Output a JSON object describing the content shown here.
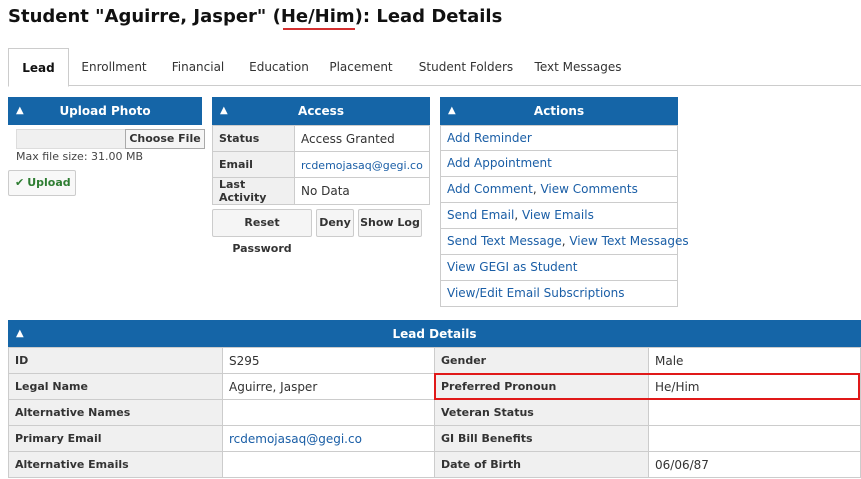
{
  "page": {
    "title_prefix": "Student \"Aguirre, Jasper\" (",
    "title_pronoun": "He/Him",
    "title_suffix": "): Lead Details"
  },
  "tabs": [
    "Lead",
    "Enrollment",
    "Financial",
    "Education",
    "Placement",
    "Student Folders",
    "Text Messages"
  ],
  "upload_photo": {
    "header": "Upload Photo",
    "choose_file_label": "Choose File",
    "max_size_text": "Max file size: 31.00 MB",
    "upload_label": "Upload"
  },
  "access": {
    "header": "Access",
    "rows": [
      {
        "label": "Status",
        "value": "Access Granted"
      },
      {
        "label": "Email",
        "value": "rcdemojasaq@gegi.co"
      },
      {
        "label": "Last Activity",
        "value": "No Data"
      }
    ],
    "buttons": [
      "Reset Password",
      "Deny",
      "Show Log"
    ]
  },
  "actions": {
    "header": "Actions",
    "items": [
      [
        "Add Reminder"
      ],
      [
        "Add Appointment"
      ],
      [
        "Add Comment",
        "View Comments"
      ],
      [
        "Send Email",
        "View Emails"
      ],
      [
        "Send Text Message",
        "View Text Messages"
      ],
      [
        "View GEGI as Student"
      ],
      [
        "View/Edit Email Subscriptions"
      ]
    ]
  },
  "lead_details": {
    "header": "Lead Details",
    "rows": [
      {
        "l1": "ID",
        "v1": "S295",
        "l2": "Gender",
        "v2": "Male"
      },
      {
        "l1": "Legal Name",
        "v1": "Aguirre, Jasper",
        "l2": "Preferred Pronoun",
        "v2": "He/Him"
      },
      {
        "l1": "Alternative Names",
        "v1": "",
        "l2": "Veteran Status",
        "v2": ""
      },
      {
        "l1": "Primary Email",
        "v1": "rcdemojasaq@gegi.co",
        "l2": "GI Bill Benefits",
        "v2": ""
      },
      {
        "l1": "Alternative Emails",
        "v1": "",
        "l2": "Date of Birth",
        "v2": "06/06/87"
      }
    ]
  }
}
